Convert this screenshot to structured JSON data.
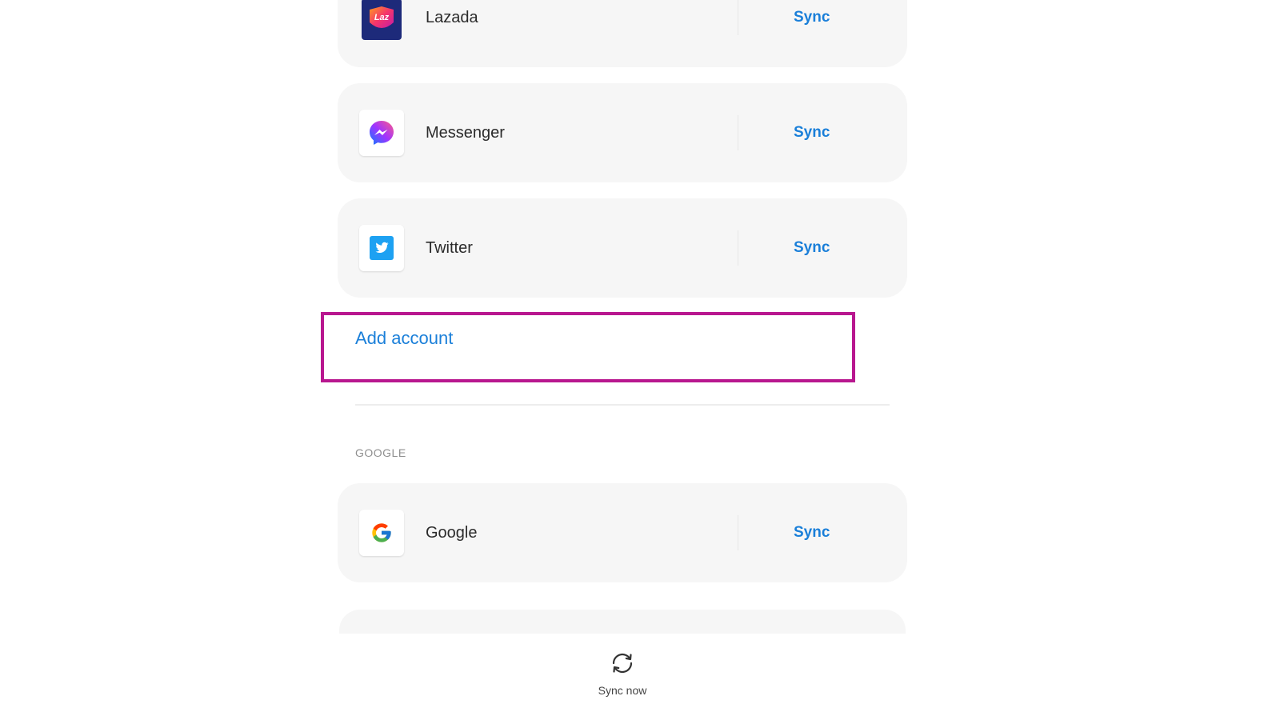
{
  "accounts": [
    {
      "name": "Lazada",
      "icon": "lazada-icon",
      "icon_text": "Laz",
      "action": "Sync"
    },
    {
      "name": "Messenger",
      "icon": "messenger-icon",
      "action": "Sync"
    },
    {
      "name": "Twitter",
      "icon": "twitter-icon",
      "action": "Sync"
    }
  ],
  "add_account": {
    "label": "Add account"
  },
  "google_section": {
    "header": "GOOGLE",
    "accounts": [
      {
        "name": "Google",
        "icon": "google-icon",
        "action": "Sync"
      }
    ]
  },
  "footer": {
    "sync_now_label": "Sync now",
    "icon": "sync-icon"
  },
  "colors": {
    "accent": "#1a7fd9",
    "highlight_border": "#b8178f",
    "card_background": "#f6f6f6",
    "section_header": "#8f8f8f"
  }
}
